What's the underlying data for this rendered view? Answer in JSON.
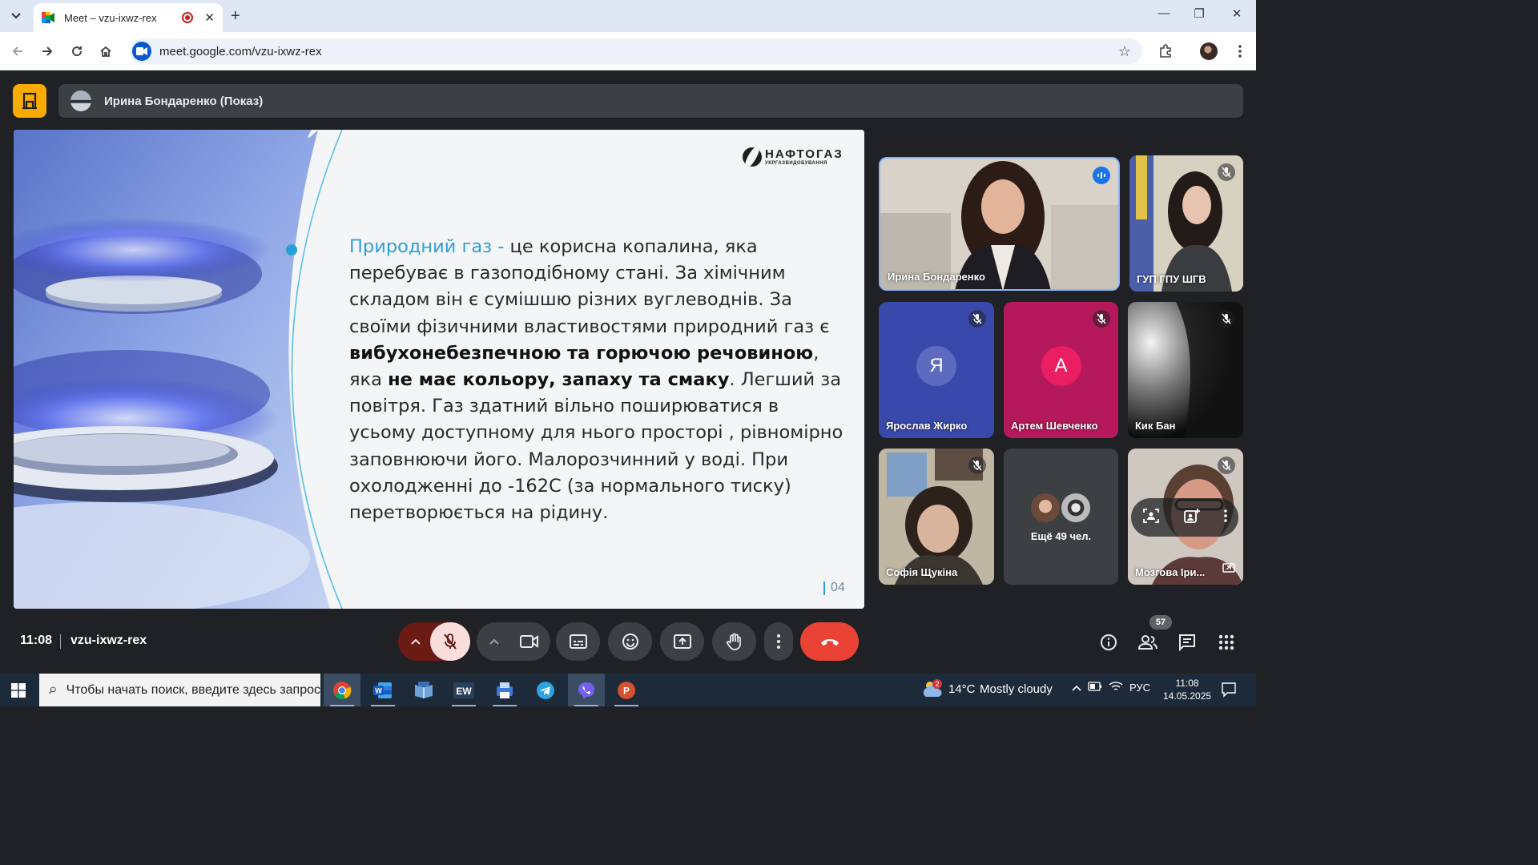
{
  "browser": {
    "tab_title": "Meet – vzu-ixwz-rex",
    "url": "meet.google.com/vzu-ixwz-rex",
    "minimize": "—",
    "restore": "❐",
    "close": "✕",
    "new_tab": "+"
  },
  "meet": {
    "presenter_label": "Ирина Бондаренко (Показ)",
    "time": "11:08",
    "meeting_code": "vzu-ixwz-rex",
    "people_count": "57"
  },
  "slide": {
    "logo_main": "НАФТОГАЗ",
    "logo_sub": "УКРГАЗВИДОБУВАННЯ",
    "highlight": "Природний газ -",
    "text_1": " це корисна копалина, яка перебуває в газоподібному стані. За хімічним складом він є сумішшю різних вуглеводнів. За своїми фізичними властивостями природний газ є ",
    "bold_1": "вибухонебезпечною та горючою речовиною",
    "text_2": ", яка ",
    "bold_2": "не має кольору, запаху та смаку",
    "text_3": ". Легший за повітря. Газ  здатний вільно поширюватися в усьому доступному для нього просторі , рівномірно заповнюючи його. Малорозчинний у воді. При охолодженні до -162С (за нормального тиску) перетворюється на рідину.",
    "page_number": "04"
  },
  "participants": [
    {
      "name": "Ирина Бондаренко",
      "speaking": true
    },
    {
      "name": "ГУП ГПУ ШГВ",
      "muted": true
    },
    {
      "name": "Ярослав Жирко",
      "initial": "Я",
      "color": "#5c6bc0",
      "muted": true
    },
    {
      "name": "Артем Шевченко",
      "initial": "А",
      "color": "#e91e63",
      "muted": true
    },
    {
      "name": "Кик Бан",
      "muted": true
    },
    {
      "name": "Софія Щукіна",
      "muted": true
    },
    {
      "name": "Ещё 49 чел."
    },
    {
      "name": "Мозгова Іри...",
      "muted": true
    }
  ],
  "taskbar": {
    "search_placeholder": "Чтобы начать поиск, введите здесь запрос",
    "weather_temp": "14°C",
    "weather_text": "Mostly cloudy",
    "weather_badge": "2",
    "language": "РУС",
    "clock_time": "11:08",
    "clock_date": "14.05.2025"
  },
  "colors": {
    "meet_bg": "#202124",
    "end_call": "#ea4335",
    "mic_off_bg": "#f9dedc",
    "present_yellow": "#f9ab00",
    "slide_accent": "#2f9ed6"
  }
}
